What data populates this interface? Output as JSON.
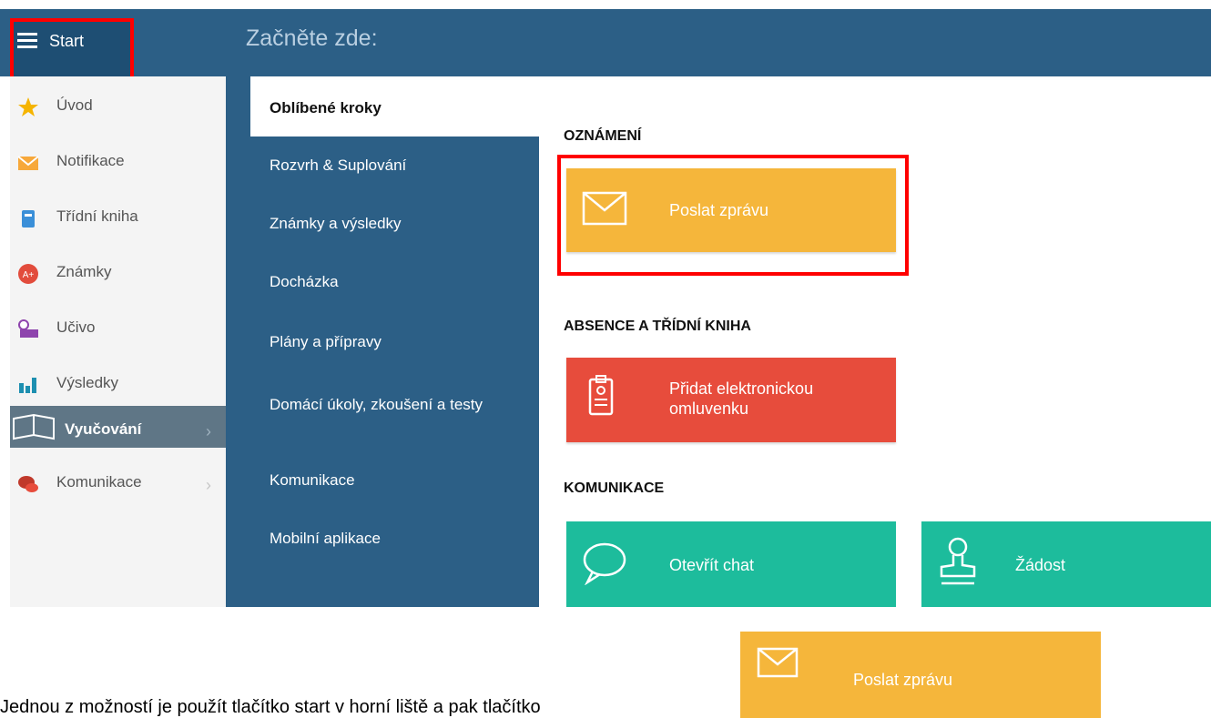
{
  "topbar": {
    "start_label": "Start",
    "title": "Začněte zde:"
  },
  "sidebar": {
    "items": [
      {
        "label": "Úvod",
        "icon": "star-icon"
      },
      {
        "label": "Notifikace",
        "icon": "envelope-icon"
      },
      {
        "label": "Třídní kniha",
        "icon": "notebook-icon"
      },
      {
        "label": "Známky",
        "icon": "grade-icon"
      },
      {
        "label": "Učivo",
        "icon": "lesson-icon"
      },
      {
        "label": "Výsledky",
        "icon": "bar-chart-icon"
      },
      {
        "label": "Vyučování",
        "icon": "book-icon"
      },
      {
        "label": "Komunikace",
        "icon": "chat-bubbles-icon"
      }
    ]
  },
  "midnav": {
    "items": [
      {
        "label": "Oblíbené kroky"
      },
      {
        "label": "Rozvrh & Suplování"
      },
      {
        "label": "Známky a výsledky"
      },
      {
        "label": "Docházka"
      },
      {
        "label": "Plány a přípravy"
      },
      {
        "label": "Domácí úkoly, zkoušení a testy"
      },
      {
        "label": "Komunikace"
      },
      {
        "label": "Mobilní aplikace"
      }
    ]
  },
  "content": {
    "oznameni": {
      "title": "OZNÁMENÍ",
      "send_label": "Poslat zprávu"
    },
    "absence": {
      "title": "ABSENCE A TŘÍDNÍ KNIHA",
      "excuse_label": "Přidat elektronickou omluvenku"
    },
    "komunikace": {
      "title": "KOMUNIKACE",
      "chat_label": "Otevřít chat",
      "request_label": "Žádost"
    }
  },
  "caption": {
    "text": "Jednou z možností je použít tlačítko start v horní liště a pak tlačítko",
    "button_label": "Poslat zprávu"
  },
  "colors": {
    "yellow": "#f5b63b",
    "red": "#e74c3c",
    "teal": "#1dbc9c",
    "navy": "#2c5f86",
    "highlight": "#ff0000"
  }
}
